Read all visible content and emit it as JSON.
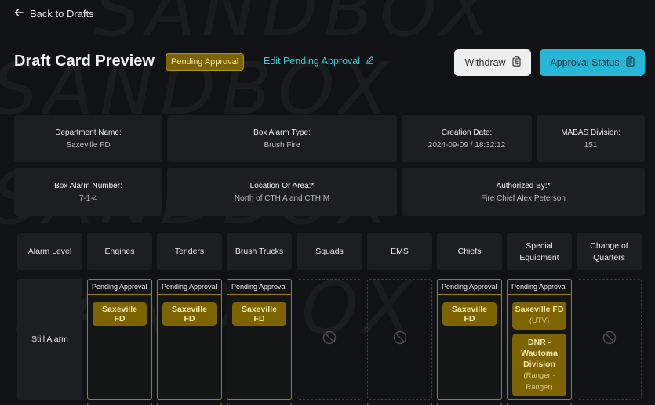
{
  "watermark": "SANDBOX",
  "nav": {
    "back_label": "Back to Drafts"
  },
  "header": {
    "title": "Draft Card Preview",
    "status_badge": "Pending Approval",
    "edit_link": "Edit Pending Approval",
    "withdraw_label": "Withdraw",
    "approval_status_label": "Approval Status"
  },
  "info": {
    "department_name": {
      "label": "Department Name:",
      "value": "Saxeville FD"
    },
    "box_alarm_type": {
      "label": "Box Alarm Type:",
      "value": "Brush Fire"
    },
    "creation_date": {
      "label": "Creation Date:",
      "value": "2024-09-09 / 18:32:12"
    },
    "mabas_division": {
      "label": "MABAS Division:",
      "value": "151"
    },
    "box_alarm_number": {
      "label": "Box Alarm Number:",
      "value": "7-1-4"
    },
    "location": {
      "label": "Location Or Area:*",
      "value": "North of CTH A and CTH M"
    },
    "authorized_by": {
      "label": "Authorized By:*",
      "value": "Fire Chief Alex Peterson"
    }
  },
  "grid": {
    "columns": [
      "Alarm Level",
      "Engines",
      "Tenders",
      "Brush Trucks",
      "Squads",
      "EMS",
      "Chiefs",
      "Special Equipment",
      "Change of Quarters"
    ],
    "rows": [
      {
        "label": "Still Alarm",
        "slot_title": "Pending Approval",
        "engines": "Saxeville FD",
        "tenders": "Saxeville FD",
        "brush_trucks": "Saxeville FD",
        "chiefs": "Saxeville FD",
        "special_equipment": [
          {
            "name": "Saxeville FD",
            "sub": "(UTV)"
          },
          {
            "name": "DNR - Wautoma Division",
            "sub": "(Ranger - Ranger)"
          }
        ]
      }
    ]
  },
  "icons": {
    "back": "arrow-left-icon",
    "edit": "pencil-icon",
    "withdraw": "withdraw-clipboard-icon",
    "approval": "clipboard-icon",
    "empty": "no-entry-icon"
  },
  "colors": {
    "background": "#111213",
    "card": "#1c1e20",
    "accent_cyan": "#27b7d6",
    "pending_gold": "#7d6400",
    "pending_border": "#9a7d10"
  }
}
